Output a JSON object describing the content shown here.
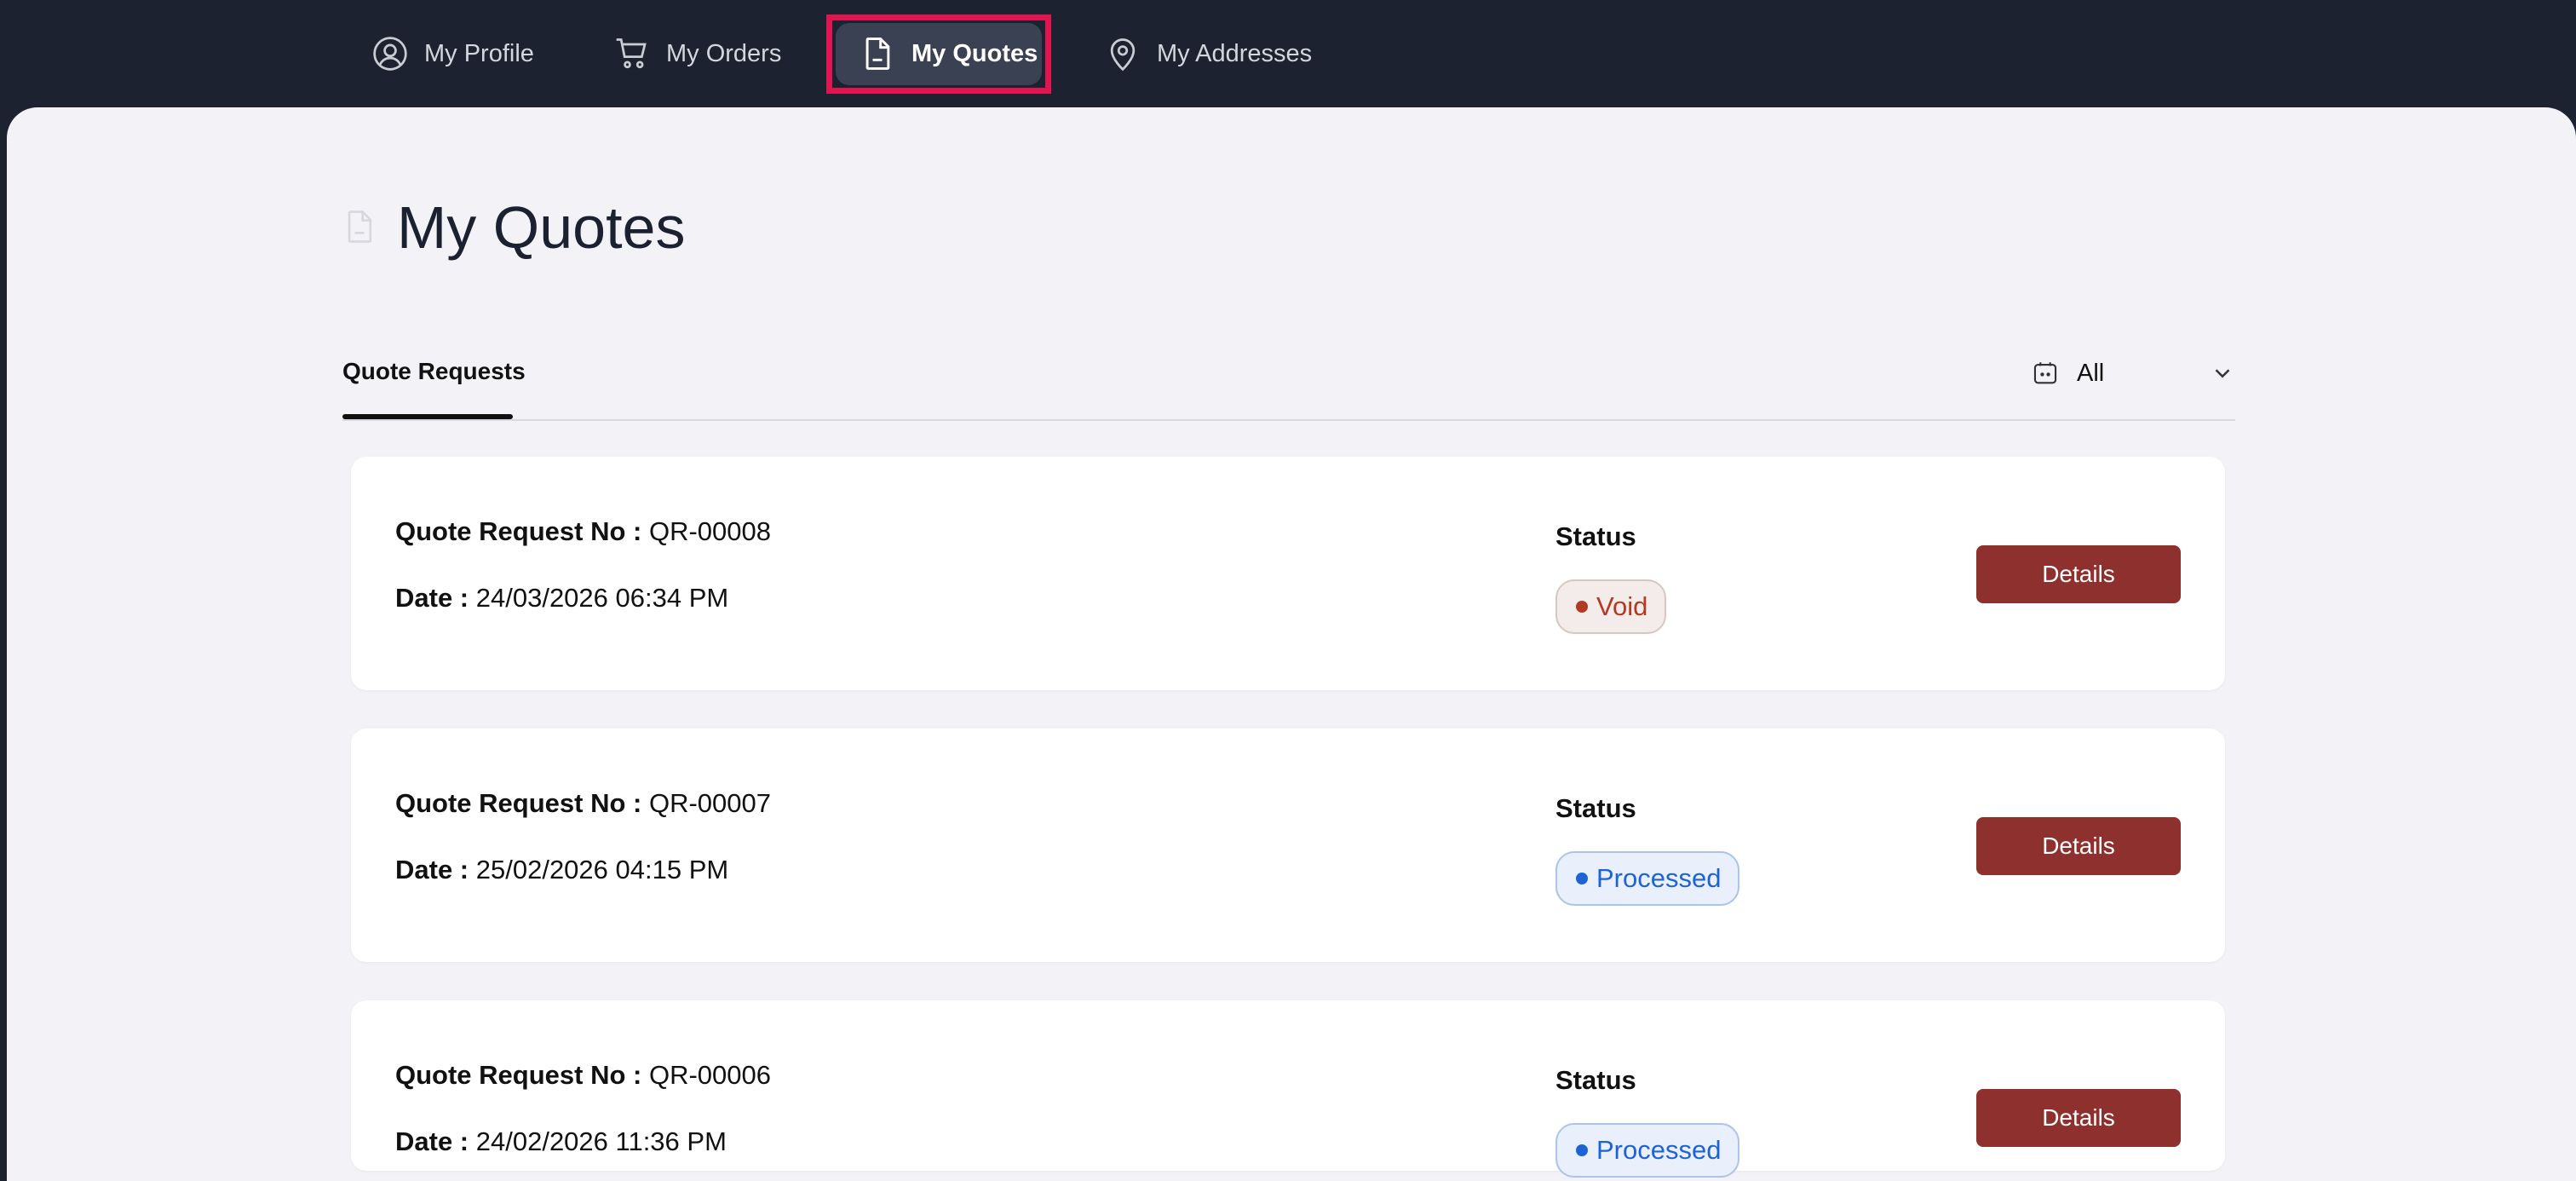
{
  "nav": {
    "items": [
      {
        "label": "My Profile",
        "icon": "user-circle-icon"
      },
      {
        "label": "My Orders",
        "icon": "cart-icon"
      },
      {
        "label": "My Quotes",
        "icon": "document-icon",
        "active": true
      },
      {
        "label": "My Addresses",
        "icon": "map-pin-icon"
      }
    ]
  },
  "page": {
    "title": "My Quotes",
    "title_icon": "document-icon"
  },
  "tabs": {
    "active_label": "Quote Requests"
  },
  "filter": {
    "value": "All",
    "icon": "calendar-icon"
  },
  "labels": {
    "quote_no": "Quote Request No :",
    "date": "Date :",
    "status": "Status",
    "details": "Details"
  },
  "quotes": [
    {
      "number": "QR-00008",
      "date": "24/03/2026 06:34 PM",
      "status": "Void"
    },
    {
      "number": "QR-00007",
      "date": "25/02/2026 04:15 PM",
      "status": "Processed"
    },
    {
      "number": "QR-00006",
      "date": "24/02/2026 11:36 PM",
      "status": "Processed"
    }
  ],
  "colors": {
    "nav_bg": "#1c2230",
    "highlight_frame": "#e0154f",
    "details_button": "#8e302e",
    "void": "#b03b22",
    "processed": "#1d63d6"
  }
}
